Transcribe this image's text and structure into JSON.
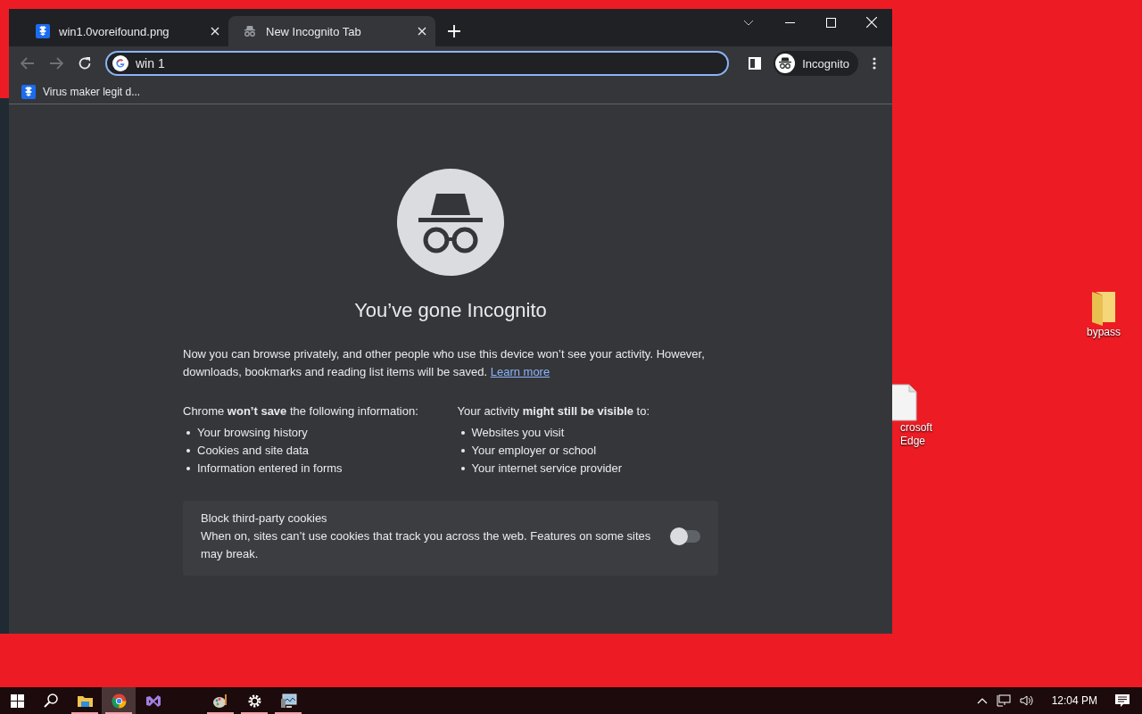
{
  "desktop": {
    "icons": [
      {
        "kind": "folder",
        "label": "bypass"
      },
      {
        "kind": "file",
        "label": "crosoft Edge"
      }
    ]
  },
  "browser": {
    "tabs": [
      {
        "kind": "dropbox",
        "title": "win1.0voreifound.png",
        "selected": false
      },
      {
        "kind": "incognito",
        "title": "New Incognito Tab",
        "selected": true
      }
    ],
    "address": {
      "value": "win 1"
    },
    "profile": {
      "label": "Incognito"
    },
    "bookmarks": [
      {
        "kind": "dropbox",
        "label": "Virus maker legit d..."
      }
    ],
    "page": {
      "title": "You’ve gone Incognito",
      "intro": "Now you can browse privately, and other people who use this device won’t see your activity. However, downloads, bookmarks and reading list items will be saved.",
      "learn_more": "Learn more",
      "columns": [
        {
          "heading": "Chrome **won’t save** the following information:",
          "items": [
            "Your browsing history",
            "Cookies and site data",
            "Information entered in forms"
          ]
        },
        {
          "heading": "Your activity **might still be visible** to:",
          "items": [
            "Websites you visit",
            "Your employer or school",
            "Your internet service provider"
          ]
        }
      ],
      "cookies": {
        "title": "Block third-party cookies",
        "description": "When on, sites can’t use cookies that track you across the web. Features on some sites may break.",
        "on": false
      }
    }
  },
  "taskbar": {
    "apps": [
      {
        "kind": "start",
        "running": false,
        "selected": false
      },
      {
        "kind": "search",
        "running": false,
        "selected": false
      },
      {
        "kind": "files",
        "running": true,
        "selected": false
      },
      {
        "kind": "chrome",
        "running": true,
        "selected": true
      },
      {
        "kind": "studio",
        "running": false,
        "selected": false
      },
      {
        "kind": "gap",
        "running": false,
        "selected": false
      },
      {
        "kind": "paint",
        "running": true,
        "selected": false
      },
      {
        "kind": "settings",
        "running": true,
        "selected": false
      },
      {
        "kind": "monitor",
        "running": true,
        "selected": false
      }
    ],
    "time": "12:04 PM"
  }
}
